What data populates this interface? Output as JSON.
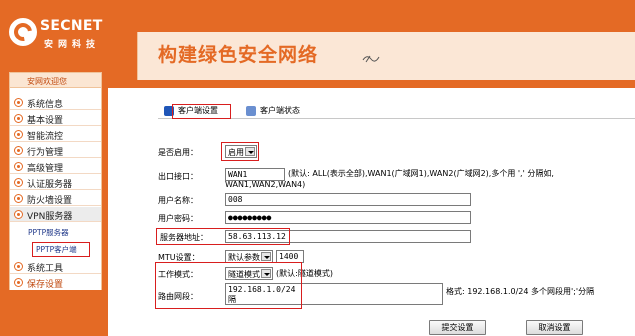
{
  "brand": {
    "name_en": "SECNET",
    "name_cn": "安网科技"
  },
  "banner": {
    "title": "构建绿色安全网络"
  },
  "sidebar": {
    "header": "安网欢迎您",
    "items": [
      {
        "label": "系统信息"
      },
      {
        "label": "基本设置"
      },
      {
        "label": "智能流控"
      },
      {
        "label": "行为管理"
      },
      {
        "label": "高级管理"
      },
      {
        "label": "认证服务器"
      },
      {
        "label": "防火墙设置"
      },
      {
        "label": "VPN服务器"
      }
    ],
    "sub_items": [
      {
        "label": "PPTP服务器"
      },
      {
        "label": "PPTP客户端"
      }
    ],
    "tools": "系统工具",
    "save": "保存设置"
  },
  "tabs": [
    {
      "label": "客户端设置",
      "active": true
    },
    {
      "label": "客户端状态",
      "active": false
    }
  ],
  "form": {
    "enable": {
      "label": "是否启用：",
      "value": "启用"
    },
    "wan": {
      "label": "出口接口：",
      "value": "WAN1",
      "hint_line1": "(默认: ALL(表示全部),WAN1(广域网1),WAN2(广域网2),多个用 ',' 分隔如,",
      "hint_line2": "WAN1,WAN2,WAN4)"
    },
    "username": {
      "label": "用户名称：",
      "value": "008"
    },
    "password": {
      "label": "用户密码：",
      "value": "●●●●●●●●●"
    },
    "server": {
      "label": "服务器地址：",
      "value": "58.63.113.12"
    },
    "mtu": {
      "label": "MTU设置：",
      "select": "默认参数",
      "value": "1400"
    },
    "mode": {
      "label": "工作模式：",
      "select": "隧道模式",
      "hint": "(默认:隧道模式)"
    },
    "route": {
      "label": "路由网段：",
      "value_line1": "192.168.1.0/24",
      "value_line2": "隔",
      "hint": "格式: 192.168.1.0/24 多个网段用';'分隔"
    }
  },
  "buttons": {
    "submit": "提交设置",
    "cancel": "取消设置"
  },
  "colors": {
    "brand_orange": "#e46a25",
    "highlight_red": "#d81e1e",
    "panel_peach": "#fbe7d6"
  }
}
